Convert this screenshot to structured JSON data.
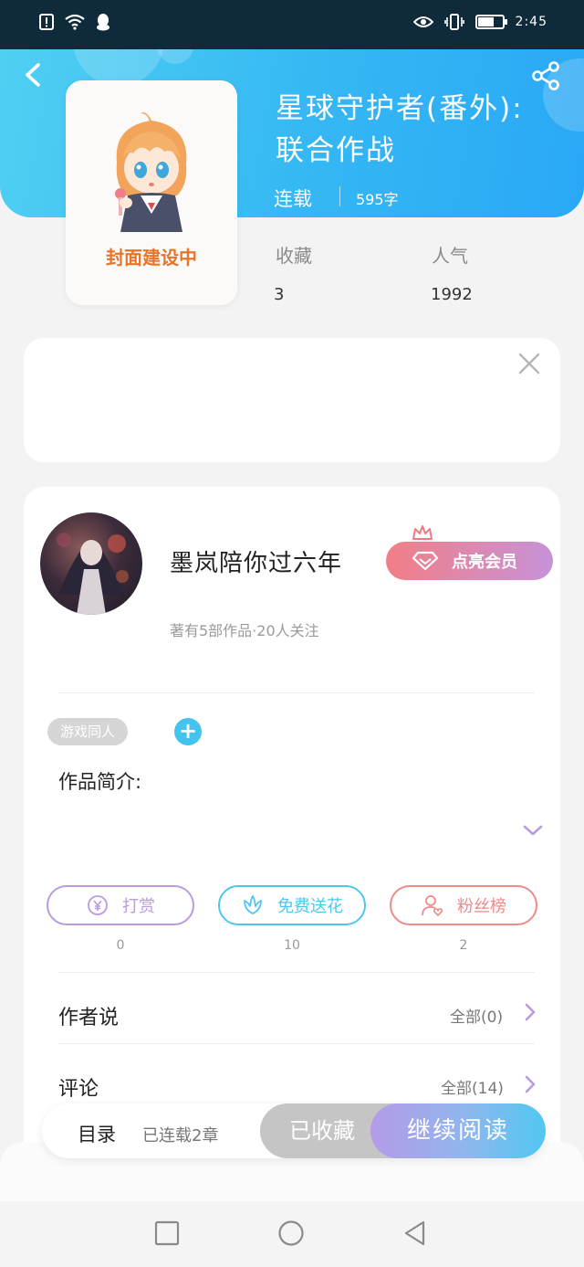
{
  "status_bar": {
    "time": "2:45",
    "battery_level": 0.62,
    "icons": [
      "alert-icon",
      "wifi-icon",
      "qq-icon",
      "eye-icon",
      "vibrate-icon",
      "battery-icon"
    ]
  },
  "book": {
    "title": "星球守护者(番外):联合作战",
    "status": "连载",
    "word_count": "595字",
    "cover_placeholder": "封面建设中",
    "stats": [
      {
        "label": "收藏",
        "value": "3"
      },
      {
        "label": "人气",
        "value": "1992"
      }
    ]
  },
  "author": {
    "name": "墨岚陪你过六年",
    "meta": "著有5部作品·20人关注",
    "vip_button": "点亮会员"
  },
  "tags": [
    "游戏同人"
  ],
  "intro": {
    "label": "作品简介:"
  },
  "actions": [
    {
      "label": "打赏",
      "count": "0",
      "color": "#b99be0",
      "icon": "yen-icon"
    },
    {
      "label": "免费送花",
      "count": "10",
      "color": "#4fc6ef",
      "icon": "flower-icon"
    },
    {
      "label": "粉丝榜",
      "count": "2",
      "color": "#ef8a8a",
      "icon": "fan-user-icon"
    }
  ],
  "rows": [
    {
      "label": "作者说",
      "right": "全部(0)"
    },
    {
      "label": "评论",
      "right": "全部(14)"
    }
  ],
  "bottom_bar": {
    "toc_label": "目录",
    "toc_meta": "已连载2章",
    "favorite_label": "已收藏",
    "read_label": "继续阅读"
  },
  "colors": {
    "header_start": "#4fd0f2",
    "header_end": "#2aa8f6",
    "accent_blue": "#45c3ef"
  }
}
